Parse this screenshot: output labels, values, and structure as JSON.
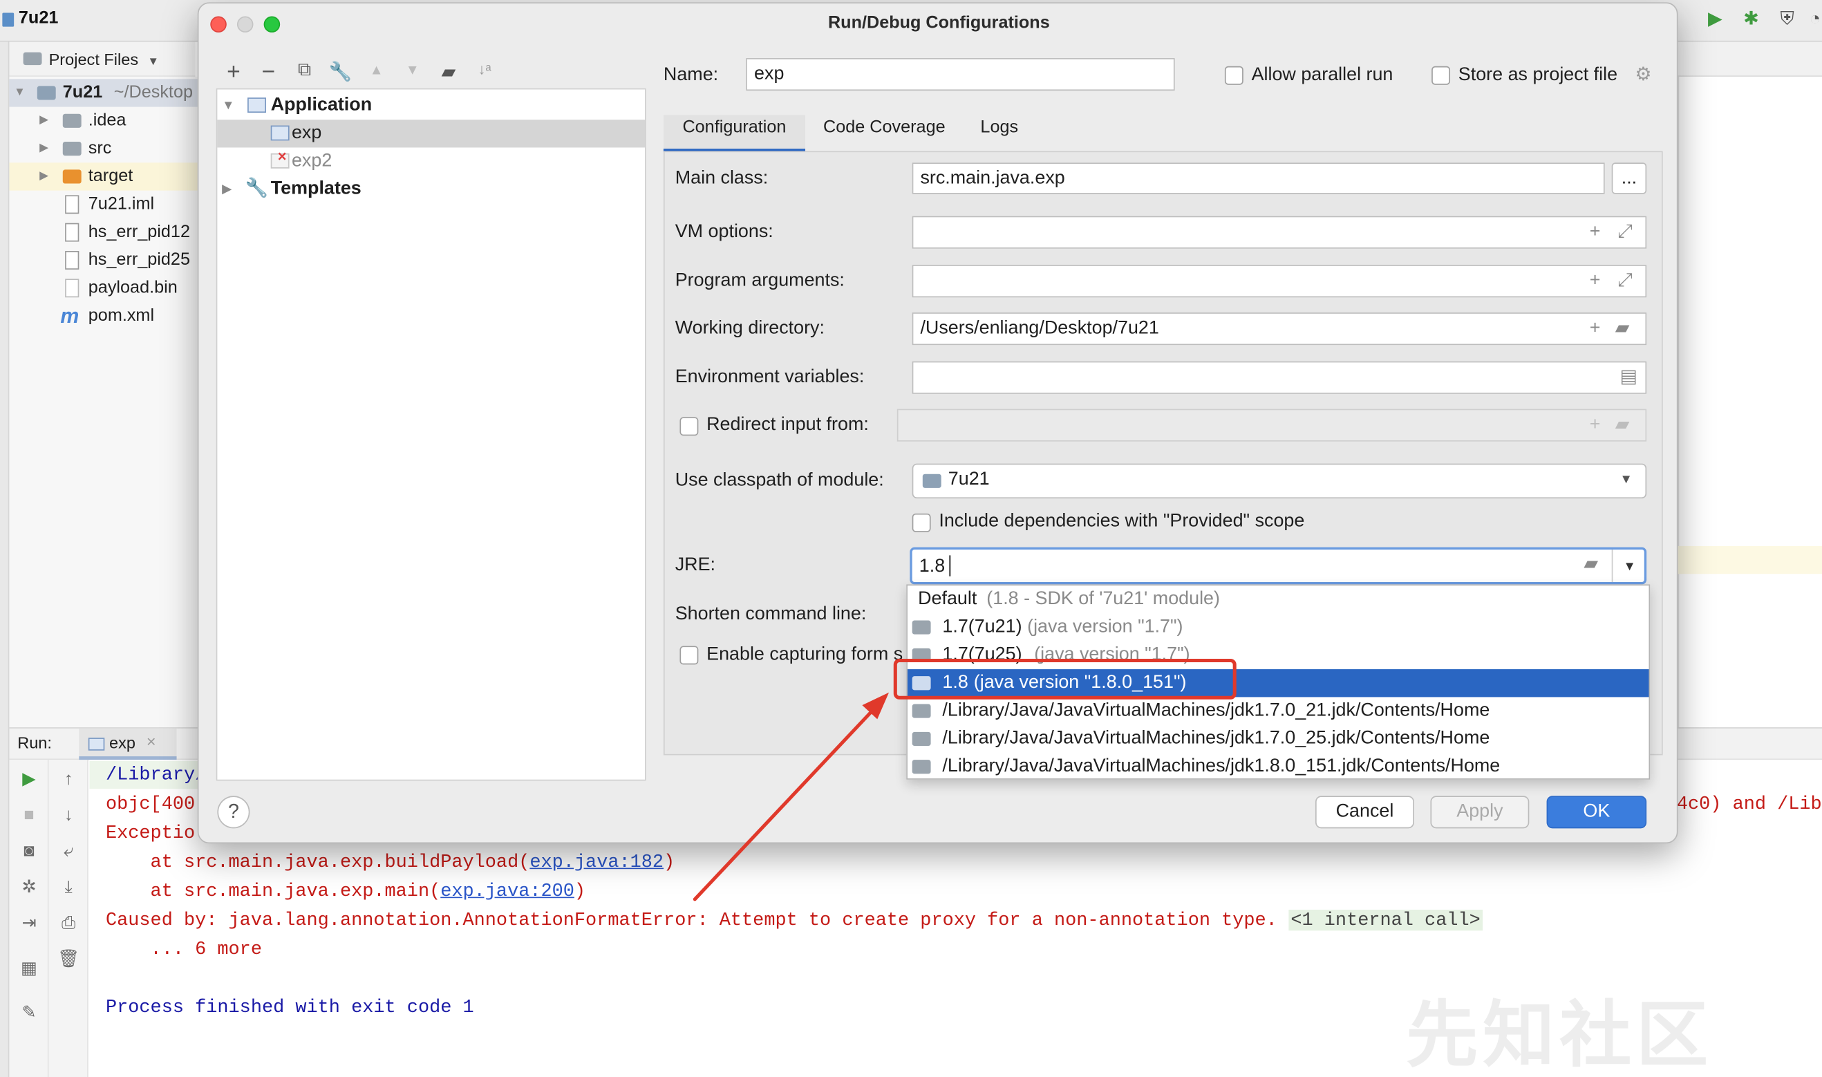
{
  "ide": {
    "title": "7u21",
    "project_header": "Project Files",
    "tree": [
      {
        "label": "7u21",
        "suffix": "~/Desktop"
      },
      {
        "label": ".idea"
      },
      {
        "label": "src"
      },
      {
        "label": "target"
      },
      {
        "label": "7u21.iml"
      },
      {
        "label": "hs_err_pid12"
      },
      {
        "label": "hs_err_pid25"
      },
      {
        "label": "payload.bin"
      },
      {
        "label": "pom.xml"
      }
    ],
    "run_label": "Run:",
    "run_tab": "exp"
  },
  "console": {
    "lines": [
      "/Library/",
      "objc[400",
      "Exceptio",
      "    at src.main.java.exp.buildPayload(",
      "exp.java:182",
      ")",
      "    at src.main.java.exp.main(",
      "exp.java:200",
      ")",
      "Caused by: java.lang.annotation.AnnotationFormatError: Attempt to create proxy for a non-annotation type.",
      "<1 internal call>",
      "    ... 6 more",
      "Process finished with exit code 1"
    ],
    "right_fragment": "4c0) and /Lib"
  },
  "watermark": "先知社区",
  "dialog": {
    "title": "Run/Debug Configurations",
    "tree": {
      "application": "Application",
      "configs": [
        "exp",
        "exp2"
      ],
      "templates": "Templates"
    },
    "name_label": "Name:",
    "name_value": "exp",
    "allow_parallel": "Allow parallel run",
    "store_project": "Store as project file",
    "tabs": [
      "Configuration",
      "Code Coverage",
      "Logs"
    ],
    "main_class_label": "Main class:",
    "main_class_value": "src.main.java.exp",
    "browse_label": "...",
    "vm_options_label": "VM options:",
    "program_args_label": "Program arguments:",
    "working_dir_label": "Working directory:",
    "working_dir_value": "/Users/enliang/Desktop/7u21",
    "env_vars_label": "Environment variables:",
    "redirect_label": "Redirect input from:",
    "classpath_label": "Use classpath of module:",
    "classpath_value": "7u21",
    "include_deps": "Include dependencies with \"Provided\" scope",
    "jre_label": "JRE:",
    "jre_value": "1.8",
    "shorten_label": "Shorten command line:",
    "capture_label": "Enable capturing form s",
    "jre_options": [
      {
        "main": "Default",
        "detail": "(1.8 - SDK of '7u21' module)"
      },
      {
        "main": "1.7(7u21)",
        "detail": "(java version \"1.7\")"
      },
      {
        "main": "1.7(7u25)",
        "detail": "(java version \"1.7\")"
      },
      {
        "main": "1.8",
        "detail": "(java version \"1.8.0_151\")"
      },
      {
        "main": "/Library/Java/JavaVirtualMachines/jdk1.7.0_21.jdk/Contents/Home",
        "detail": ""
      },
      {
        "main": "/Library/Java/JavaVirtualMachines/jdk1.7.0_25.jdk/Contents/Home",
        "detail": ""
      },
      {
        "main": "/Library/Java/JavaVirtualMachines/jdk1.8.0_151.jdk/Contents/Home",
        "detail": ""
      }
    ],
    "selected_jre_index": 3,
    "buttons": {
      "help": "?",
      "cancel": "Cancel",
      "apply": "Apply",
      "ok": "OK"
    }
  },
  "colors": {
    "accent": "#2a66c2",
    "highlight_box": "#e0392b",
    "error_text": "#c41a16"
  }
}
